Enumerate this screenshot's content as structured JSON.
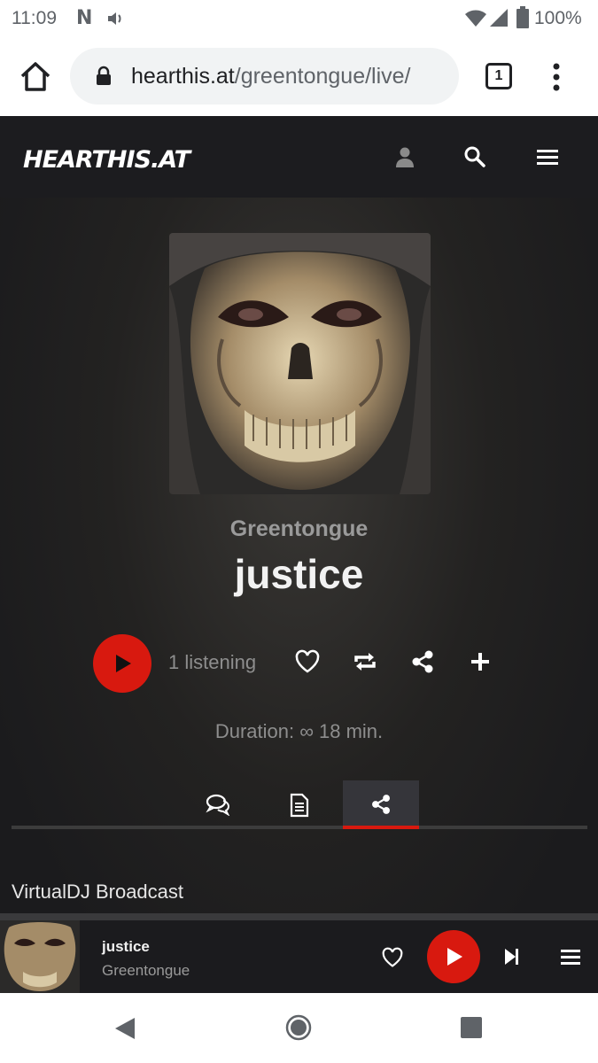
{
  "status_bar": {
    "time": "11:09",
    "notif_icon": "N",
    "battery": "100%"
  },
  "browser": {
    "url_domain": "hearthis.at",
    "url_path": "/greentongue/live/",
    "tab_count": "1"
  },
  "site": {
    "logo": "HEARTHIS.AT",
    "header_icons": [
      "user-icon",
      "search-icon",
      "hamburger-menu-icon"
    ]
  },
  "track": {
    "artist": "Greentongue",
    "title": "justice",
    "listening": "1 listening",
    "duration": "Duration: ∞   18 min."
  },
  "tabs": [
    {
      "icon": "comments-icon",
      "active": false
    },
    {
      "icon": "document-icon",
      "active": false
    },
    {
      "icon": "share-icon",
      "active": true
    }
  ],
  "section": {
    "title": "VirtualDJ Broadcast"
  },
  "mini_player": {
    "title": "justice",
    "artist": "Greentongue"
  },
  "colors": {
    "accent": "#d8190f",
    "header_bg": "#1c1c1f"
  }
}
